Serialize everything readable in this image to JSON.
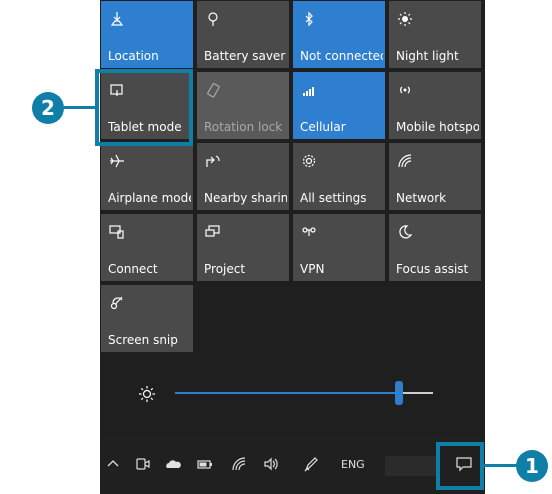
{
  "tiles": [
    {
      "label": "Location",
      "state": "on",
      "icon": "location-icon"
    },
    {
      "label": "Battery saver",
      "state": "off",
      "icon": "battery-saver-icon"
    },
    {
      "label": "Not connected",
      "state": "on",
      "icon": "bluetooth-icon"
    },
    {
      "label": "Night light",
      "state": "off",
      "icon": "night-light-icon"
    },
    {
      "label": "Tablet mode",
      "state": "off",
      "icon": "tablet-mode-icon"
    },
    {
      "label": "Rotation lock",
      "state": "disabled",
      "icon": "rotation-lock-icon"
    },
    {
      "label": "Cellular",
      "state": "on",
      "icon": "cellular-icon"
    },
    {
      "label": "Mobile hotspot",
      "state": "off",
      "icon": "mobile-hotspot-icon"
    },
    {
      "label": "Airplane mode",
      "state": "off",
      "icon": "airplane-icon"
    },
    {
      "label": "Nearby sharing",
      "state": "off",
      "icon": "nearby-sharing-icon"
    },
    {
      "label": "All settings",
      "state": "off",
      "icon": "settings-icon"
    },
    {
      "label": "Network",
      "state": "off",
      "icon": "network-icon"
    },
    {
      "label": "Connect",
      "state": "off",
      "icon": "connect-icon"
    },
    {
      "label": "Project",
      "state": "off",
      "icon": "project-icon"
    },
    {
      "label": "VPN",
      "state": "off",
      "icon": "vpn-icon"
    },
    {
      "label": "Focus assist",
      "state": "off",
      "icon": "focus-assist-icon"
    },
    {
      "label": "Screen snip",
      "state": "off",
      "icon": "screen-snip-icon"
    }
  ],
  "brightness": {
    "icon": "brightness-icon",
    "level": 0.87
  },
  "taskbar": {
    "icons": [
      "chevron-up-icon",
      "meet-now-icon",
      "onedrive-icon",
      "battery-icon",
      "wifi-icon",
      "volume-icon",
      "pen-icon"
    ],
    "language": "ENG",
    "action_center_icon": "action-center-icon"
  },
  "callouts": {
    "one": "1",
    "two": "2"
  },
  "colors": {
    "accent": "#2f7fd1",
    "callout": "#0f7fa8",
    "tile_off": "#4a4a4a",
    "panel": "#1f1f1f"
  }
}
